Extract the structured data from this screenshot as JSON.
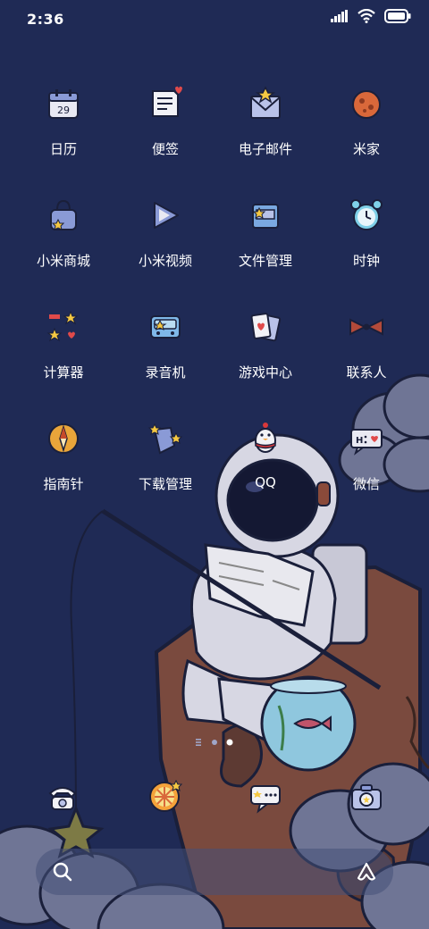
{
  "status_bar": {
    "time": "2:36"
  },
  "apps": [
    {
      "label": "日历",
      "icon": "calendar-icon",
      "date": "29"
    },
    {
      "label": "便签",
      "icon": "notes-icon"
    },
    {
      "label": "电子邮件",
      "icon": "email-icon"
    },
    {
      "label": "米家",
      "icon": "mi-home-icon"
    },
    {
      "label": "小米商城",
      "icon": "mi-store-icon"
    },
    {
      "label": "小米视频",
      "icon": "mi-video-icon"
    },
    {
      "label": "文件管理",
      "icon": "file-manager-icon"
    },
    {
      "label": "时钟",
      "icon": "clock-icon"
    },
    {
      "label": "计算器",
      "icon": "calculator-icon"
    },
    {
      "label": "录音机",
      "icon": "recorder-icon"
    },
    {
      "label": "游戏中心",
      "icon": "game-center-icon"
    },
    {
      "label": "联系人",
      "icon": "contacts-icon"
    },
    {
      "label": "指南针",
      "icon": "compass-icon"
    },
    {
      "label": "下载管理",
      "icon": "download-manager-icon"
    },
    {
      "label": "QQ",
      "icon": "qq-icon"
    },
    {
      "label": "微信",
      "icon": "wechat-icon"
    }
  ],
  "dock": [
    {
      "icon": "phone-icon"
    },
    {
      "icon": "browser-icon"
    },
    {
      "icon": "messages-icon"
    },
    {
      "icon": "camera-icon"
    }
  ],
  "page_indicator": {
    "pages": 3,
    "current": 3
  },
  "search_bar": {
    "left_icon": "search-icon",
    "right_icon": "assistant-icon"
  },
  "colors": {
    "background": "#1f2a55",
    "rock": "#7a4a3e",
    "cloud": "#6f7595",
    "astronaut": "#d7d7e3",
    "label_text": "#ffffff"
  }
}
